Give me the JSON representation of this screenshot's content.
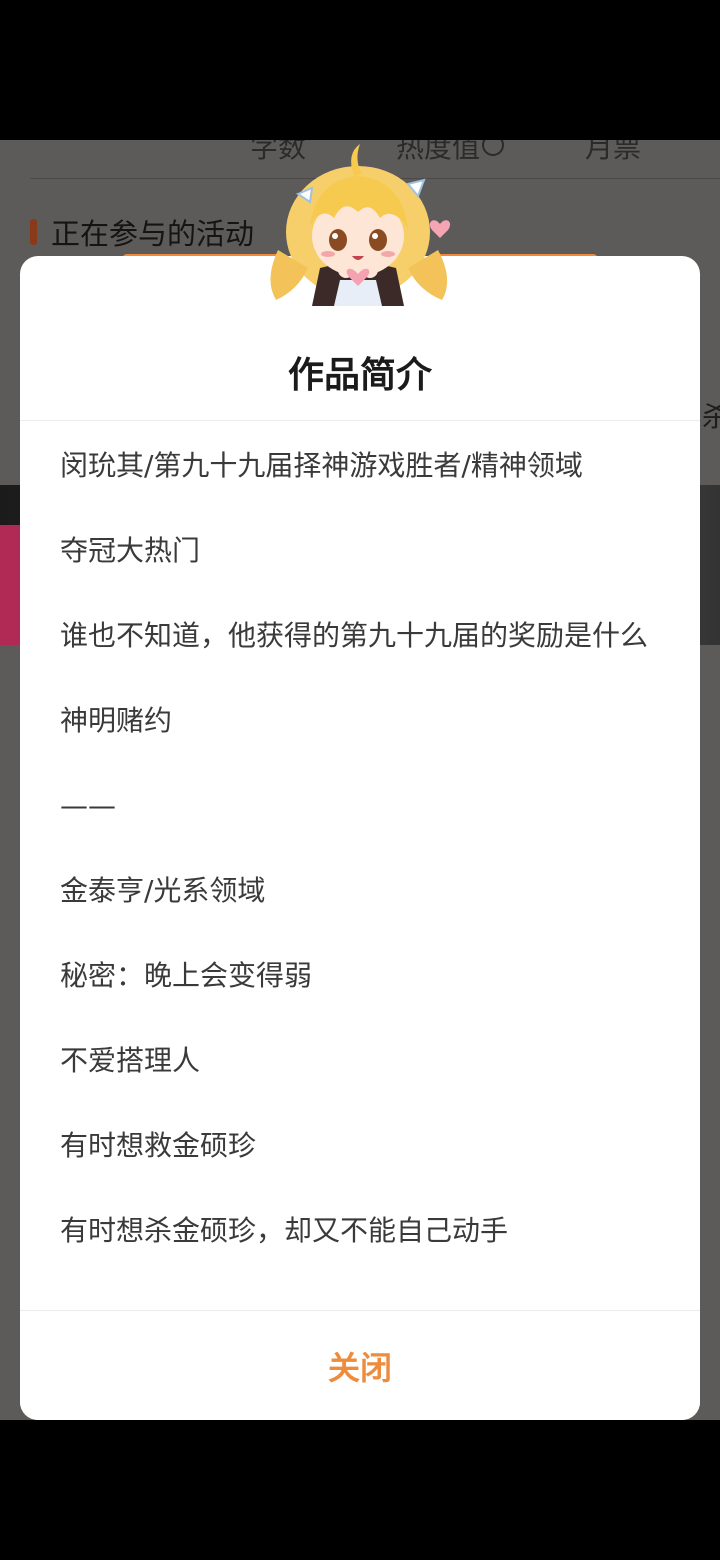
{
  "background": {
    "section_title": "正在参与的活动",
    "partial_right_text": "杀"
  },
  "modal": {
    "title": "作品简介",
    "paragraphs": [
      "闵玧其/第九十九届择神游戏胜者/精神领域",
      "夺冠大热门",
      "谁也不知道，他获得的第九十九届的奖励是什么",
      "神明赌约",
      "——",
      "金泰亨/光系领域",
      "秘密：晚上会变得弱",
      "不爱搭理人",
      "有时想救金硕珍",
      "有时想杀金硕珍，却又不能自己动手"
    ],
    "close_label": "关闭"
  },
  "colors": {
    "accent": "#ee8c3d",
    "overlay": "#5d5b5a"
  }
}
